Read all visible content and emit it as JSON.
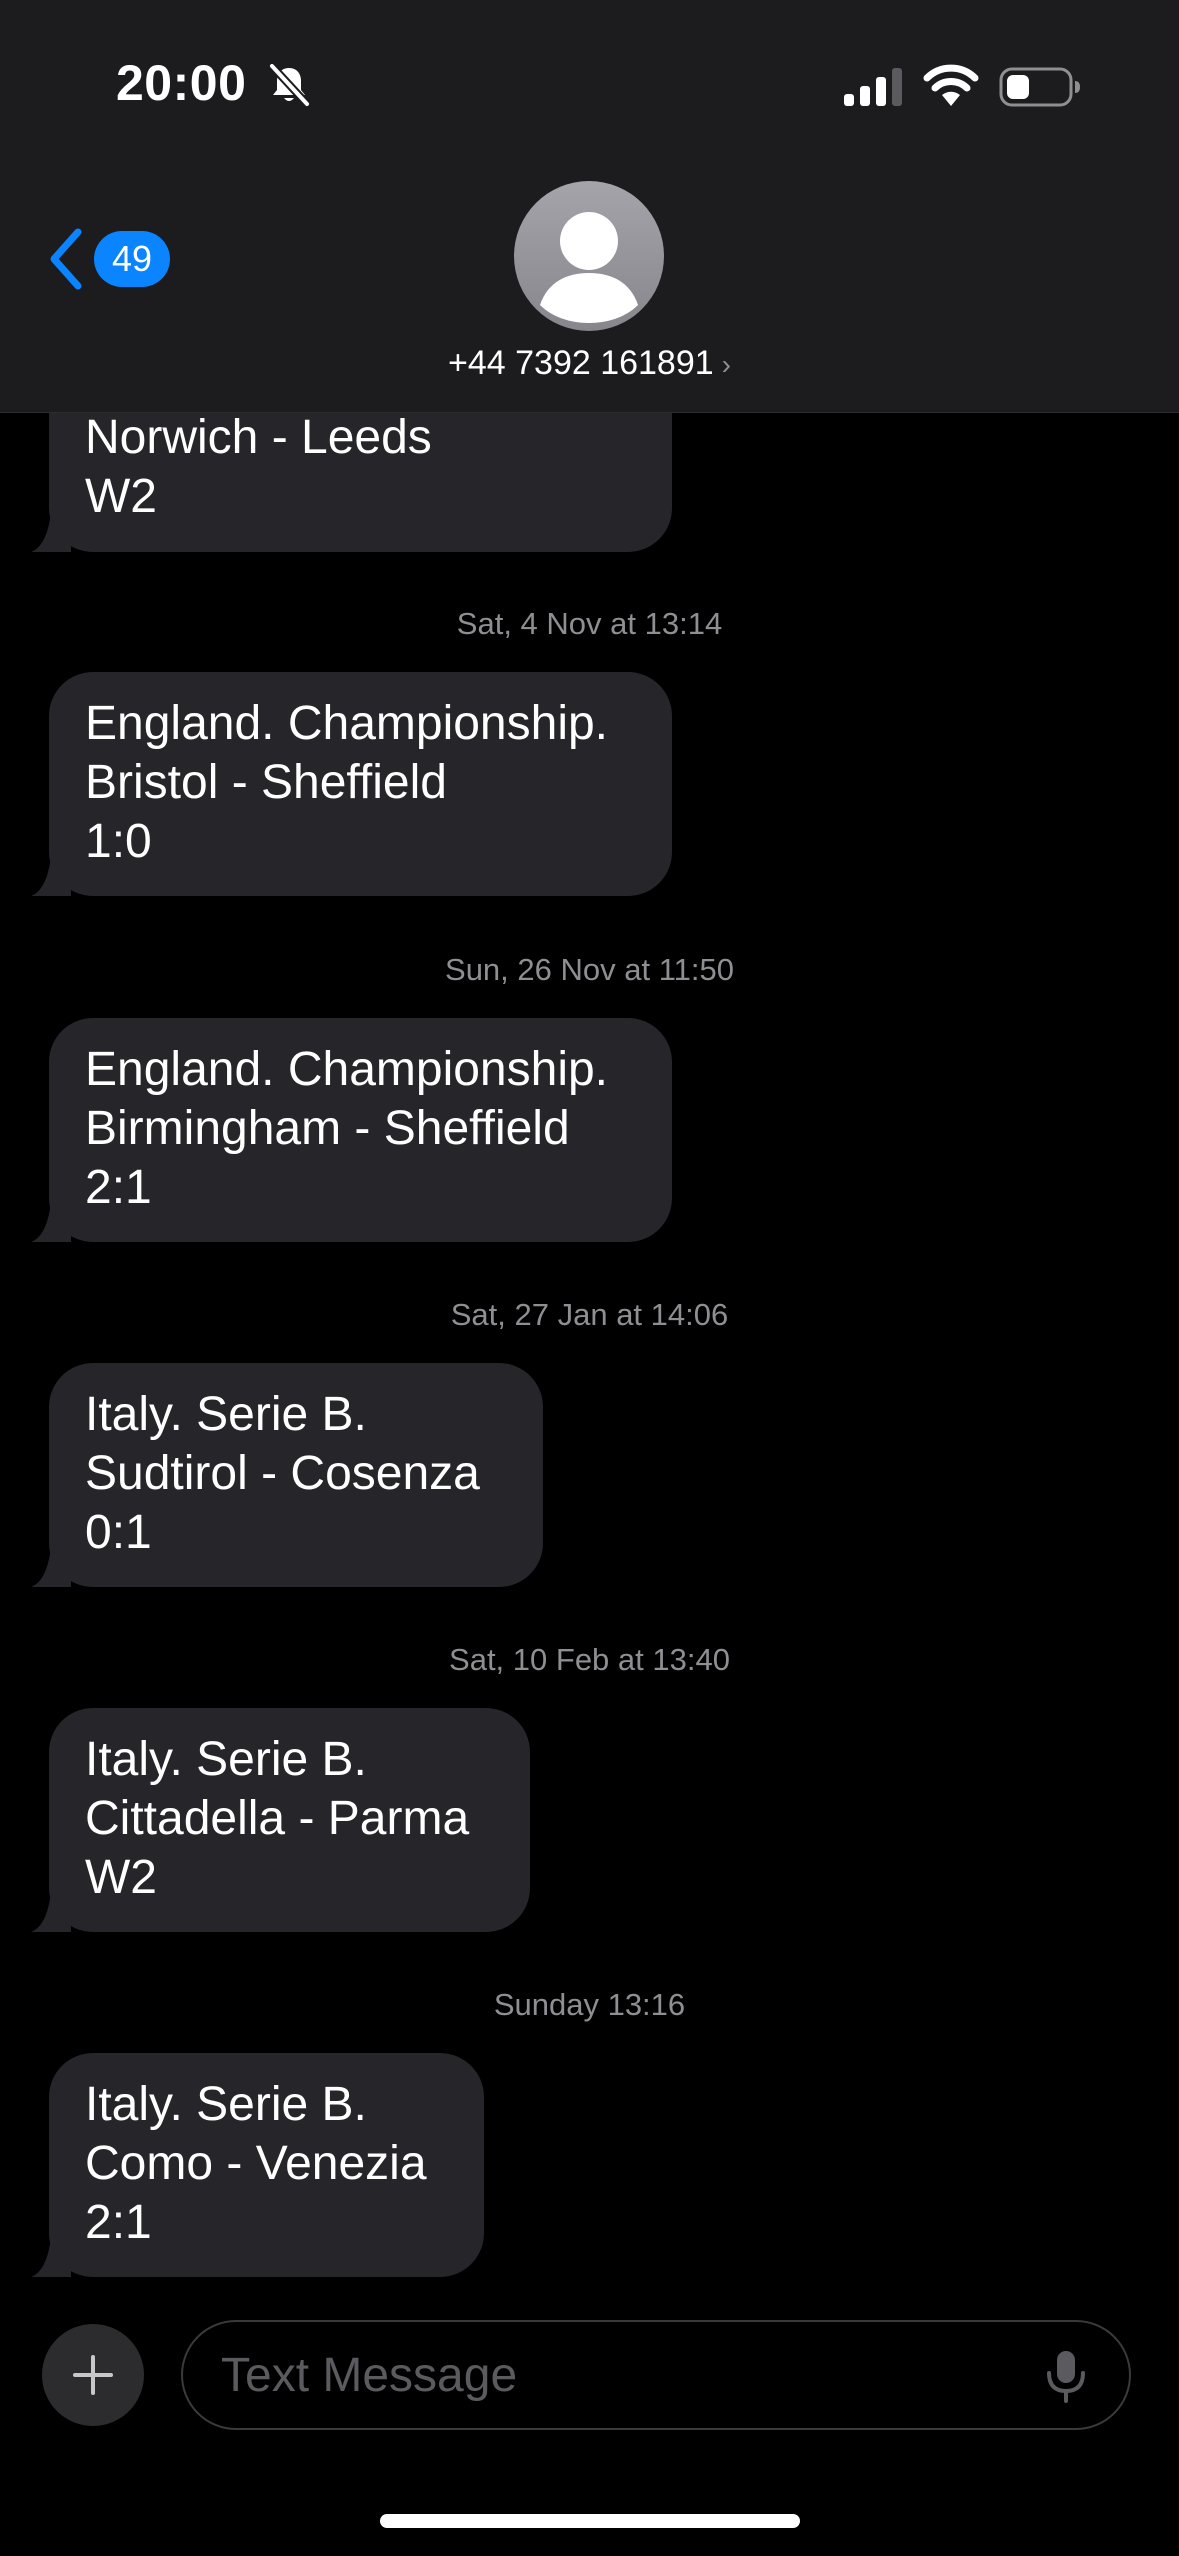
{
  "status_bar": {
    "time": "20:00",
    "icons": [
      "bell-slash-icon",
      "cellular-signal-icon",
      "wifi-icon",
      "battery-icon"
    ]
  },
  "header": {
    "back_badge": "49",
    "contact": "+44 7392 161891",
    "contact_chevron": "›"
  },
  "messages": [
    {
      "lines": [
        "Norwich - Leeds",
        "W2"
      ]
    },
    {
      "timestamp": "Sat, 4 Nov at 13:14",
      "lines": [
        "England. Championship.",
        "Bristol - Sheffield",
        "1:0"
      ]
    },
    {
      "timestamp": "Sun, 26 Nov at 11:50",
      "lines": [
        "England. Championship.",
        "Birmingham - Sheffield",
        "2:1"
      ]
    },
    {
      "timestamp": "Sat, 27 Jan at 14:06",
      "lines": [
        "Italy. Serie B.",
        "Sudtirol - Cosenza",
        "0:1"
      ]
    },
    {
      "timestamp": "Sat, 10 Feb at 13:40",
      "lines": [
        "Italy. Serie B.",
        "Cittadella - Parma",
        "W2"
      ]
    },
    {
      "timestamp": "Sunday 13:16",
      "lines": [
        "Italy. Serie B.",
        "Como - Venezia",
        "2:1"
      ]
    }
  ],
  "compose": {
    "placeholder": "Text Message",
    "value": ""
  },
  "colors": {
    "accent": "#0a84ff",
    "incoming_bubble": "#26252a",
    "background": "#000000",
    "header_background": "#1c1c1e",
    "timestamp_text": "#8e8e93"
  }
}
